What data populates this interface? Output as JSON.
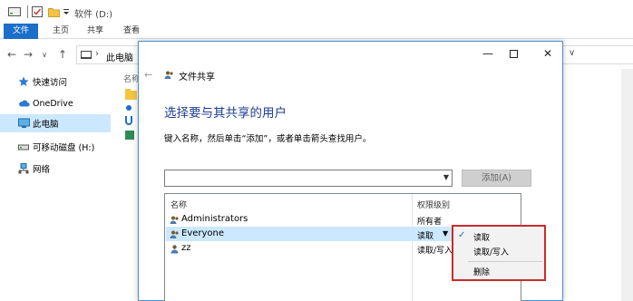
{
  "explorer": {
    "window_title": "软件 (D:)",
    "ribbon_tabs": [
      "文件",
      "主页",
      "共享",
      "查看"
    ],
    "address_path": "此电脑",
    "sidebar": [
      {
        "label": "快速访问",
        "icon": "star-icon"
      },
      {
        "label": "OneDrive",
        "icon": "cloud-icon"
      },
      {
        "label": "此电脑",
        "icon": "computer-icon",
        "selected": true
      },
      {
        "label": "可移动磁盘 (H:)",
        "icon": "usb-drive-icon"
      },
      {
        "label": "网络",
        "icon": "network-icon"
      }
    ],
    "column_name": "名称"
  },
  "dialog": {
    "title": "文件共享",
    "heading": "选择要与其共享的用户",
    "instruction": "键入名称，然后单击“添加”，或者单击箭头查找用户。",
    "input_value": "",
    "add_button": "添加(A)",
    "columns": {
      "name": "名称",
      "permission": "权限级别"
    },
    "rows": [
      {
        "name": "Administrators",
        "permission": "所有者"
      },
      {
        "name": "Everyone",
        "permission": "读取",
        "selected": true
      },
      {
        "name": "zz",
        "permission": "读取/写入"
      }
    ]
  },
  "permission_menu": {
    "items": [
      {
        "label": "读取",
        "checked": true
      },
      {
        "label": "读取/写入",
        "checked": false
      },
      {
        "label": "删除",
        "checked": false
      }
    ]
  },
  "colors": {
    "accent": "#1a6fc9",
    "selection": "#cce8ff",
    "heading": "#1e3e93",
    "highlight_border": "#cc2b2b"
  }
}
